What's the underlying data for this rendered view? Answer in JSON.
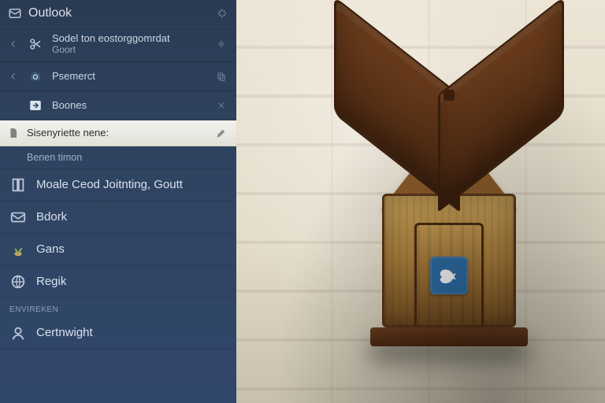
{
  "app": {
    "title": "Outlook"
  },
  "top": {
    "item1_label": "Sodel ton eostorggomrdat",
    "item1_sub": "Goort",
    "item2_label": "Psemerct",
    "item3_label": "Boones"
  },
  "selected": {
    "label": "Sisenyriette nene:"
  },
  "sub": {
    "label": "Benen timon"
  },
  "nav": {
    "item1": "Moale Ceod Joitnting, Goutt",
    "item2": "Bdork",
    "item3": "Gans",
    "item4": "Regik",
    "section": "ENVIREKEN",
    "item5": "Certnwight"
  }
}
